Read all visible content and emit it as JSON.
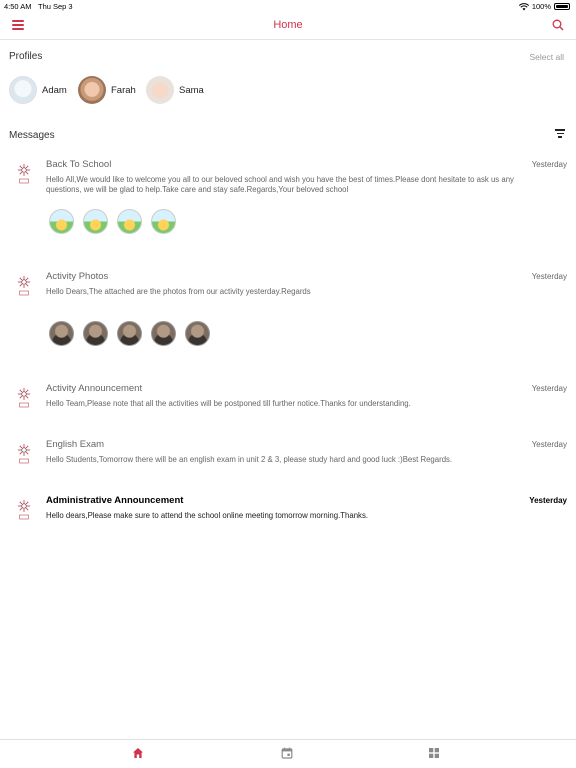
{
  "status_bar": {
    "time": "4:50 AM",
    "date": "Thu Sep 3",
    "battery": "100%"
  },
  "nav": {
    "title": "Home",
    "icons": {
      "left": "menu-icon",
      "right": "search-icon"
    }
  },
  "profiles": {
    "heading": "Profiles",
    "select_all": "Select all",
    "items": [
      {
        "name": "Adam"
      },
      {
        "name": "Farah"
      },
      {
        "name": "Sama"
      }
    ]
  },
  "messages": {
    "heading": "Messages",
    "items": [
      {
        "title": "Back To School",
        "date": "Yesterday",
        "body": "Hello All,We would like to welcome you all to our beloved school and wish you have the best of times.Please dont hesitate to ask us any questions, we will be glad to help.Take care and stay safe.Regards,Your beloved school",
        "attachments": 4,
        "unread": false
      },
      {
        "title": "Activity Photos",
        "date": "Yesterday",
        "body": "Hello Dears,The attached are the photos from our activity yesterday.Regards",
        "attachments": 5,
        "unread": false
      },
      {
        "title": "Activity Announcement",
        "date": "Yesterday",
        "body": "Hello Team,Please note that all the activities will be postponed till further notice.Thanks for understanding.",
        "attachments": 0,
        "unread": false
      },
      {
        "title": "English Exam",
        "date": "Yesterday",
        "body": "Hello Students,Tomorrow there will be an english exam in unit 2 & 3, please study hard and good luck :)Best Regards.",
        "attachments": 0,
        "unread": false
      },
      {
        "title": "Administrative Announcement",
        "date": "Yesterday",
        "body": "Hello dears,Please make sure to attend the school online meeting tomorrow morning.Thanks.",
        "attachments": 0,
        "unread": true
      }
    ]
  },
  "tab_bar": {
    "tabs": [
      {
        "icon": "home-icon",
        "active": true
      },
      {
        "icon": "calendar-icon",
        "active": false
      },
      {
        "icon": "grid-icon",
        "active": false
      }
    ]
  },
  "colors": {
    "accent": "#d0344c",
    "text": "#222222",
    "muted": "#666666"
  }
}
